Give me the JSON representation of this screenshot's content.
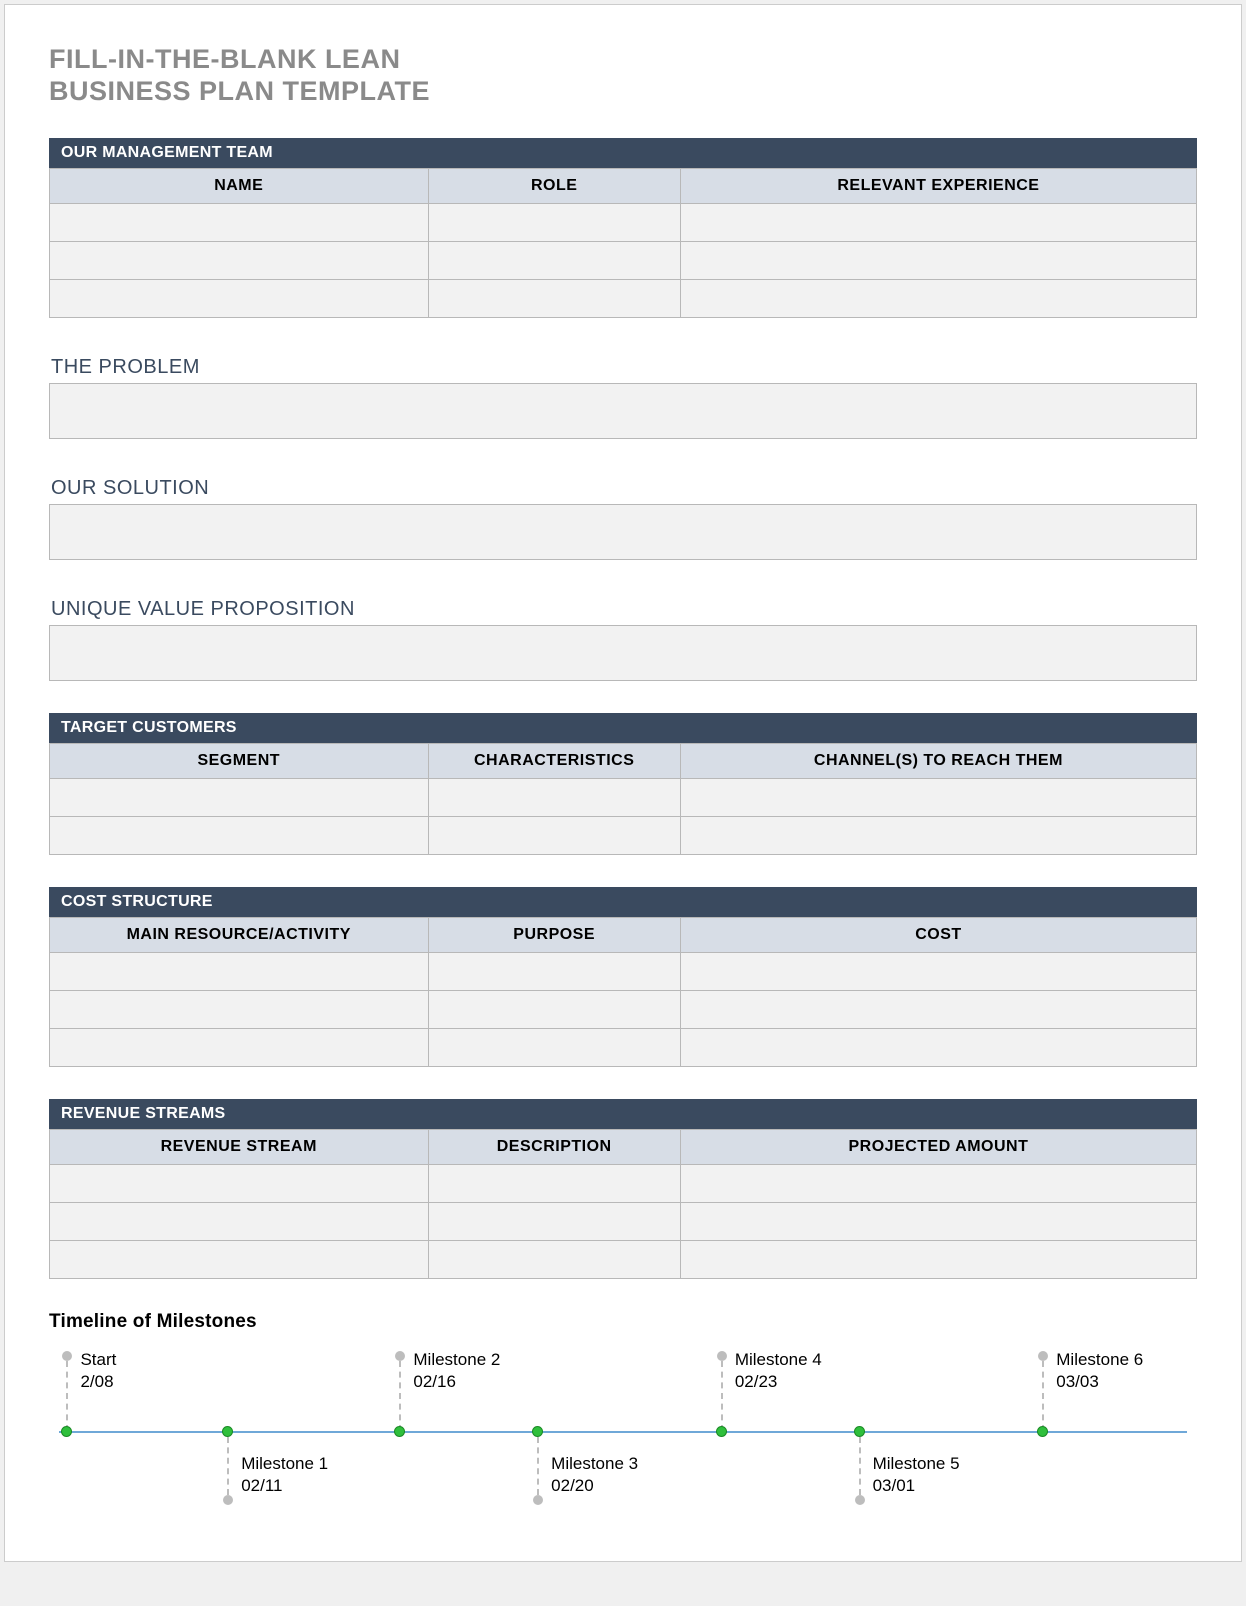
{
  "title_line1": "FILL-IN-THE-BLANK LEAN",
  "title_line2": "BUSINESS PLAN TEMPLATE",
  "mgmt": {
    "header": "OUR MANAGEMENT TEAM",
    "cols": [
      "NAME",
      "ROLE",
      "RELEVANT EXPERIENCE"
    ],
    "rows": [
      [
        "",
        "",
        ""
      ],
      [
        "",
        "",
        ""
      ],
      [
        "",
        "",
        ""
      ]
    ]
  },
  "problem": {
    "label": "THE PROBLEM",
    "value": ""
  },
  "solution": {
    "label": "OUR SOLUTION",
    "value": ""
  },
  "uvp": {
    "label": "UNIQUE VALUE PROPOSITION",
    "value": ""
  },
  "target": {
    "header": "TARGET CUSTOMERS",
    "cols": [
      "SEGMENT",
      "CHARACTERISTICS",
      "CHANNEL(S) TO REACH THEM"
    ],
    "rows": [
      [
        "",
        "",
        ""
      ],
      [
        "",
        "",
        ""
      ]
    ]
  },
  "cost": {
    "header": "COST STRUCTURE",
    "cols": [
      "MAIN RESOURCE/ACTIVITY",
      "PURPOSE",
      "COST"
    ],
    "rows": [
      [
        "",
        "",
        ""
      ],
      [
        "",
        "",
        ""
      ],
      [
        "",
        "",
        ""
      ]
    ]
  },
  "revenue": {
    "header": "REVENUE STREAMS",
    "cols": [
      "REVENUE STREAM",
      "DESCRIPTION",
      "PROJECTED AMOUNT"
    ],
    "rows": [
      [
        "",
        "",
        ""
      ],
      [
        "",
        "",
        ""
      ],
      [
        "",
        "",
        ""
      ]
    ]
  },
  "timeline": {
    "title": "Timeline of Milestones",
    "items": [
      {
        "name": "Start",
        "date": "2/08",
        "pos": 1,
        "side": "top"
      },
      {
        "name": "Milestone 1",
        "date": "02/11",
        "pos": 15,
        "side": "bot"
      },
      {
        "name": "Milestone 2",
        "date": "02/16",
        "pos": 30,
        "side": "top"
      },
      {
        "name": "Milestone 3",
        "date": "02/20",
        "pos": 42,
        "side": "bot"
      },
      {
        "name": "Milestone 4",
        "date": "02/23",
        "pos": 58,
        "side": "top"
      },
      {
        "name": "Milestone 5",
        "date": "03/01",
        "pos": 70,
        "side": "bot"
      },
      {
        "name": "Milestone 6",
        "date": "03/03",
        "pos": 86,
        "side": "top"
      }
    ]
  }
}
